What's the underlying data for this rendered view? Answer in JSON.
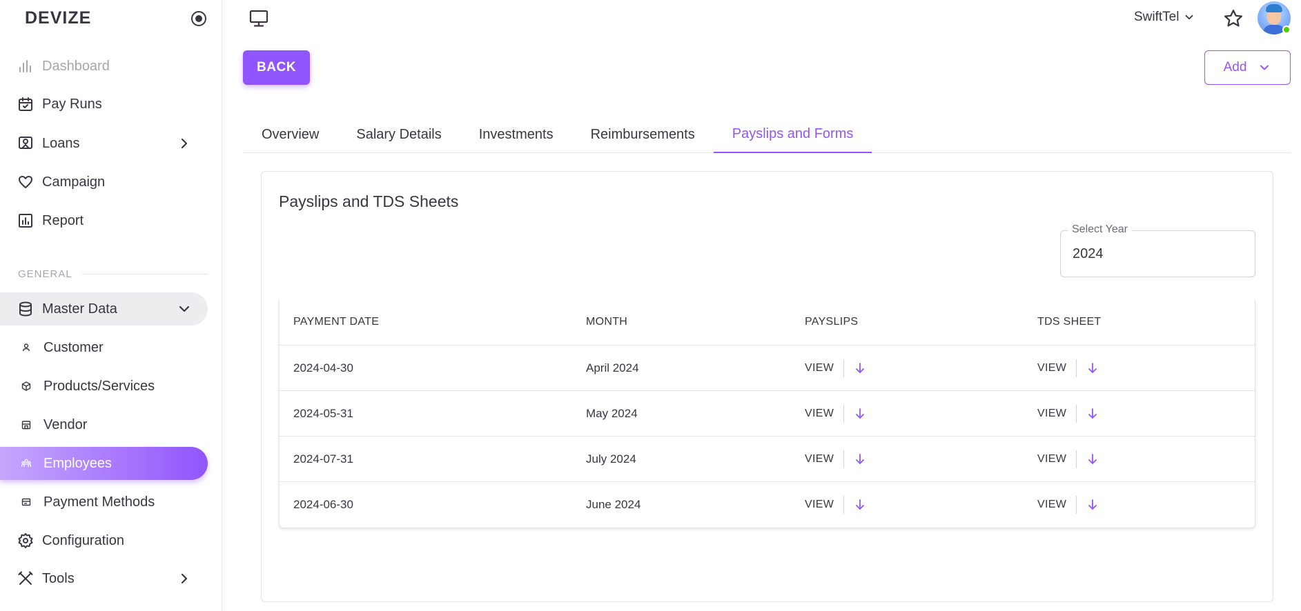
{
  "brand": "DEVIZE",
  "sidebar": {
    "items": [
      {
        "label": "Dashboard",
        "icon": "bar-chart-icon"
      },
      {
        "label": "Pay Runs",
        "icon": "calendar-check-icon"
      },
      {
        "label": "Loans",
        "icon": "id-badge-icon"
      },
      {
        "label": "Campaign",
        "icon": "heart-icon"
      },
      {
        "label": "Report",
        "icon": "report-chart-icon"
      }
    ],
    "section_general": "GENERAL",
    "master_data": "Master Data",
    "sub_items": [
      {
        "label": "Customer",
        "icon": "user-icon"
      },
      {
        "label": "Products/Services",
        "icon": "cube-icon"
      },
      {
        "label": "Vendor",
        "icon": "store-icon"
      },
      {
        "label": "Employees",
        "icon": "employees-icon"
      },
      {
        "label": "Payment Methods",
        "icon": "card-icon"
      }
    ],
    "bottom_items": [
      {
        "label": "Configuration",
        "icon": "gear-icon"
      },
      {
        "label": "Tools",
        "icon": "tools-icon"
      }
    ]
  },
  "topbar": {
    "company": "SwiftTel"
  },
  "actions": {
    "back": "BACK",
    "add": "Add"
  },
  "tabs": [
    {
      "label": "Overview"
    },
    {
      "label": "Salary Details"
    },
    {
      "label": "Investments"
    },
    {
      "label": "Reimbursements"
    },
    {
      "label": "Payslips and Forms"
    }
  ],
  "card": {
    "title": "Payslips and TDS Sheets",
    "year_label": "Select Year",
    "year_value": "2024"
  },
  "table": {
    "headers": {
      "payment_date": "PAYMENT DATE",
      "month": "MONTH",
      "payslips": "PAYSLIPS",
      "tds_sheet": "TDS SHEET"
    },
    "view_label": "VIEW",
    "rows": [
      {
        "date": "2024-04-30",
        "month": "April 2024"
      },
      {
        "date": "2024-05-31",
        "month": "May 2024"
      },
      {
        "date": "2024-07-31",
        "month": "July 2024"
      },
      {
        "date": "2024-06-30",
        "month": "June 2024"
      }
    ]
  },
  "colors": {
    "accent": "#9155fd",
    "text": "#3a3541",
    "muted": "#a8a5ae",
    "online": "#56ca00"
  }
}
